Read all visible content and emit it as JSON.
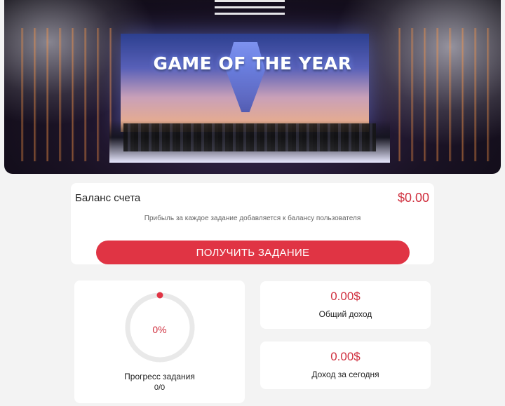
{
  "banner": {
    "title": "GAME OF THE YEAR"
  },
  "balance": {
    "label": "Баланс счета",
    "value": "$0.00",
    "note": "Прибыль за каждое задание добавляется к балансу пользователя",
    "button_label": "ПОЛУЧИТЬ ЗАДАНИЕ"
  },
  "progress": {
    "percent_text": "0%",
    "percent_value": 0,
    "label": "Прогресс задания",
    "count": "0/0"
  },
  "stats": {
    "total": {
      "value": "0.00$",
      "label": "Общий доход"
    },
    "today": {
      "value": "0.00$",
      "label": "Доход за сегодня"
    }
  },
  "colors": {
    "accent": "#e03444",
    "value_red": "#d0303f",
    "ring_track": "#e9e9e9",
    "background": "#f3f3f3"
  }
}
